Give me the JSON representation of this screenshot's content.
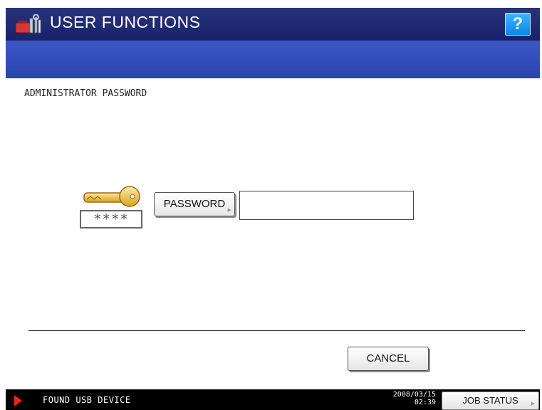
{
  "header": {
    "title": "USER FUNCTIONS",
    "help_label": "?",
    "app_icon": "tools-icon"
  },
  "main": {
    "heading": "ADMINISTRATOR PASSWORD",
    "key_icon": "key-icon",
    "masked_hint": "****",
    "password_button_label": "PASSWORD",
    "password_value": "",
    "cancel_label": "CANCEL"
  },
  "status_bar": {
    "alert_icon": "alert-arrow-icon",
    "message": "FOUND USB DEVICE",
    "date": "2008/03/15",
    "time": "02:39",
    "job_status_label": "JOB STATUS"
  },
  "colors": {
    "header_dark": "#1f2a74",
    "header_band": "#3450bd",
    "help_button": "#1a9bf0",
    "alert_red": "#e8251c"
  }
}
